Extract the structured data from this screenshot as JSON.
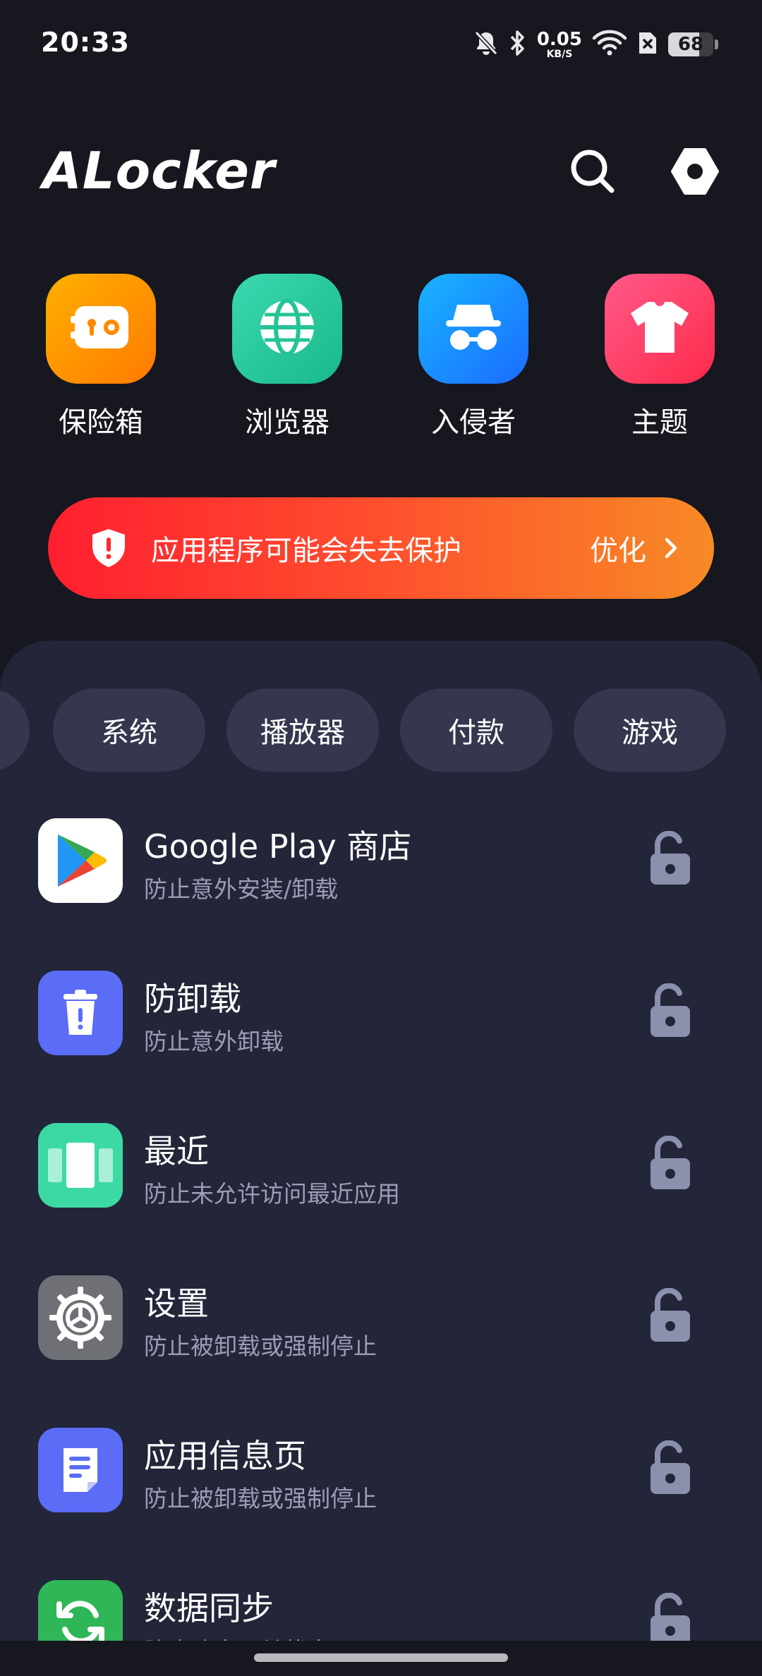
{
  "status_bar": {
    "time": "20:33",
    "net_speed_value": "0.05",
    "net_speed_unit": "KB/S",
    "battery_percent": "68",
    "battery_level": 0.68,
    "icons": [
      "bell-muted-icon",
      "bluetooth-icon",
      "wifi-icon",
      "sim-off-icon",
      "battery-icon"
    ]
  },
  "header": {
    "title": "ALocker",
    "icons": [
      "search-icon",
      "settings-hex-icon"
    ]
  },
  "tools": [
    {
      "label": "保险箱",
      "icon": "vault-icon",
      "color": "#ff9500"
    },
    {
      "label": "浏览器",
      "icon": "globe-icon",
      "color": "#23c79a"
    },
    {
      "label": "入侵者",
      "icon": "intruder-icon",
      "color": "#1a8cff"
    },
    {
      "label": "主题",
      "icon": "shirt-icon",
      "color": "#ff3a6a"
    }
  ],
  "banner": {
    "message": "应用程序可能会失去保护",
    "action": "优化",
    "icon": "shield-alert-icon"
  },
  "categories": [
    "系统",
    "播放器",
    "付款",
    "游戏"
  ],
  "apps": [
    {
      "name": "Google Play 商店",
      "desc": "防止意外安装/卸载",
      "icon": "google-play-icon"
    },
    {
      "name": "防卸载",
      "desc": "防止意外卸载",
      "icon": "trash-alert-icon"
    },
    {
      "name": "最近",
      "desc": "防止未允许访问最近应用",
      "icon": "recents-icon"
    },
    {
      "name": "设置",
      "desc": "防止被卸载或强制停止",
      "icon": "gear-icon"
    },
    {
      "name": "应用信息页",
      "desc": "防止被卸载或强制停止",
      "icon": "app-info-icon"
    },
    {
      "name": "数据同步",
      "desc": "防止改变开关状态",
      "icon": "sync-icon"
    }
  ],
  "colors": {
    "background": "#16171f",
    "sheet": "#232538",
    "chip": "#35374f",
    "lock": "#8b90ad",
    "secondary_text": "#9a9db4"
  }
}
